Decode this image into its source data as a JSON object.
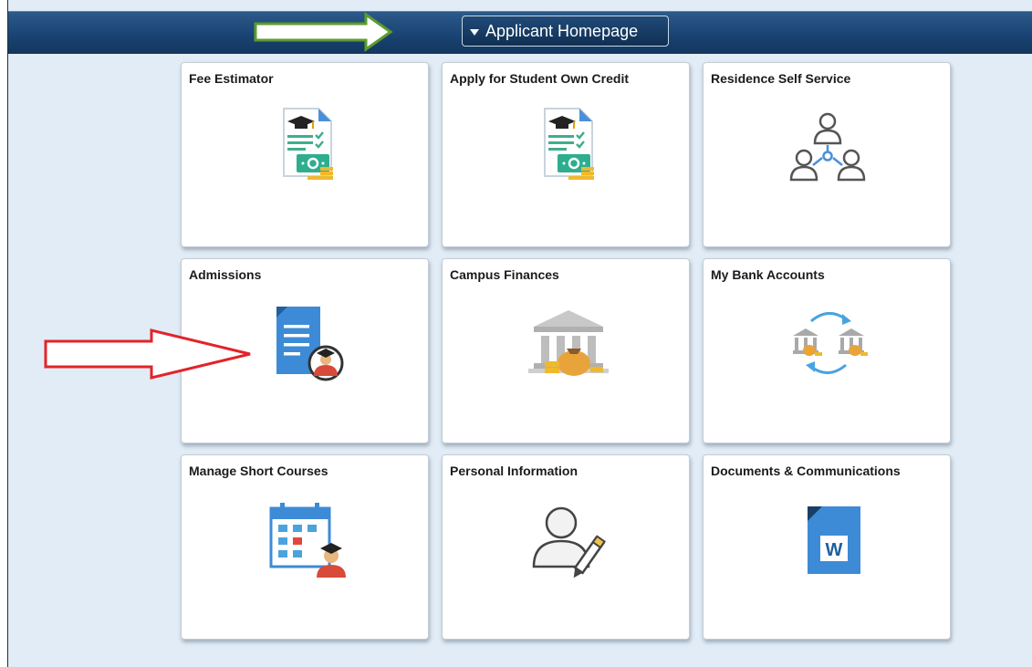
{
  "header": {
    "homepage_label": "Applicant Homepage"
  },
  "tiles": [
    {
      "label": "Fee Estimator",
      "icon": "fee-estimator-icon"
    },
    {
      "label": "Apply for Student Own Credit",
      "icon": "credit-application-icon"
    },
    {
      "label": "Residence Self Service",
      "icon": "people-network-icon"
    },
    {
      "label": "Admissions",
      "icon": "admissions-document-icon"
    },
    {
      "label": "Campus Finances",
      "icon": "bank-building-money-icon"
    },
    {
      "label": "My Bank Accounts",
      "icon": "bank-transfer-icon"
    },
    {
      "label": "Manage Short Courses",
      "icon": "calendar-graduate-icon"
    },
    {
      "label": "Personal Information",
      "icon": "user-edit-icon"
    },
    {
      "label": "Documents & Communications",
      "icon": "word-document-icon"
    }
  ],
  "colors": {
    "topbar": "#1a4473",
    "background": "#e1ecf6",
    "annotation_green": "#5d9c2c",
    "annotation_red": "#e3232a"
  }
}
